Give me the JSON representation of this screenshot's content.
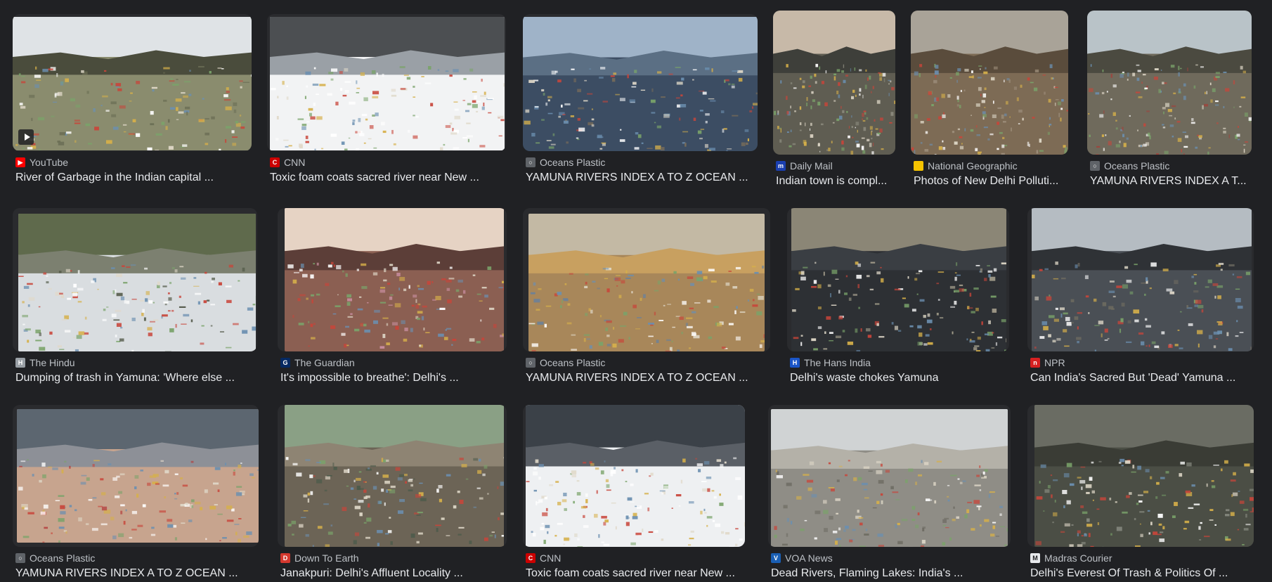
{
  "results": [
    {
      "source": "YouTube",
      "title": "River of Garbage in the Indian capital ...",
      "favicon_icon": "youtube-icon",
      "favicon_color": "#ff0000",
      "favicon_glyph": "▶",
      "thumb_colors": [
        "#dfe3e6",
        "#8a8c6e",
        "#6b6e55",
        "#4a4c3c"
      ],
      "has_play": true
    },
    {
      "source": "CNN",
      "title": "Toxic foam coats sacred river near New ...",
      "favicon_icon": "cnn-icon",
      "favicon_color": "#cc0000",
      "favicon_glyph": "C",
      "thumb_colors": [
        "#4c4f52",
        "#f2f3f4",
        "#ffffff",
        "#9aa0a6"
      ],
      "has_play": false
    },
    {
      "source": "Oceans Plastic",
      "title": "YAMUNA RIVERS INDEX A TO Z OCEAN ...",
      "favicon_icon": "oceans-plastic-icon",
      "favicon_color": "#5f6368",
      "favicon_glyph": "○",
      "thumb_colors": [
        "#9fb3c8",
        "#3c4d63",
        "#7a6d59",
        "#5b6f84"
      ],
      "has_play": false
    },
    {
      "source": "Daily Mail",
      "title": "Indian town is compl...",
      "favicon_icon": "daily-mail-icon",
      "favicon_color": "#1a3fb0",
      "favicon_glyph": "m",
      "thumb_colors": [
        "#c7b9a8",
        "#5f5d52",
        "#8b8a7d",
        "#3e3f3a"
      ],
      "has_play": false
    },
    {
      "source": "National Geographic",
      "title": "Photos of New Delhi Polluti...",
      "favicon_icon": "national-geographic-icon",
      "favicon_color": "#f6c400",
      "favicon_glyph": "",
      "thumb_colors": [
        "#a9a398",
        "#7d6b55",
        "#9c8d7a",
        "#5a4c3c"
      ],
      "has_play": false
    },
    {
      "source": "Oceans Plastic",
      "title": "YAMUNA RIVERS INDEX A T...",
      "favicon_icon": "oceans-plastic-icon",
      "favicon_color": "#5f6368",
      "favicon_glyph": "○",
      "thumb_colors": [
        "#b9c3c8",
        "#6f6a5c",
        "#a0423b",
        "#4b4a40"
      ],
      "has_play": false
    },
    {
      "source": "The Hindu",
      "title": "Dumping of trash in Yamuna: 'Where else ...",
      "favicon_icon": "the-hindu-icon",
      "favicon_color": "#9aa0a6",
      "favicon_glyph": "H",
      "thumb_colors": [
        "#5f6a4c",
        "#d9dde0",
        "#4b5240",
        "#7c8070"
      ],
      "has_play": false
    },
    {
      "source": "The Guardian",
      "title": "It's impossible to breathe': Delhi's ...",
      "favicon_icon": "the-guardian-icon",
      "favicon_color": "#052962",
      "favicon_glyph": "G",
      "thumb_colors": [
        "#e6d3c4",
        "#8b5f52",
        "#c98ea0",
        "#5c3e38"
      ],
      "has_play": false
    },
    {
      "source": "Oceans Plastic",
      "title": "YAMUNA RIVERS INDEX A TO Z OCEAN ...",
      "favicon_icon": "oceans-plastic-icon",
      "favicon_color": "#5f6368",
      "favicon_glyph": "○",
      "thumb_colors": [
        "#c3b9a4",
        "#a8875a",
        "#6c8198",
        "#c8a060"
      ],
      "has_play": false
    },
    {
      "source": "The Hans India",
      "title": "Delhi's waste chokes Yamuna",
      "favicon_icon": "the-hans-india-icon",
      "favicon_color": "#1a55c8",
      "favicon_glyph": "H",
      "thumb_colors": [
        "#8b8676",
        "#2d3034",
        "#a6a08d",
        "#3a3e43"
      ],
      "has_play": false
    },
    {
      "source": "NPR",
      "title": "Can India's Sacred But 'Dead' Yamuna ...",
      "favicon_icon": "npr-icon",
      "favicon_color": "#d62021",
      "favicon_glyph": "n",
      "thumb_colors": [
        "#b5bcc2",
        "#4a4f55",
        "#6d6a60",
        "#2f3236"
      ],
      "has_play": false
    },
    {
      "source": "Oceans Plastic",
      "title": "YAMUNA RIVERS INDEX A TO Z OCEAN ...",
      "favicon_icon": "oceans-plastic-icon",
      "favicon_color": "#5f6368",
      "favicon_glyph": "○",
      "thumb_colors": [
        "#5c6670",
        "#c7a48e",
        "#b33a3a",
        "#8d9097"
      ],
      "has_play": false
    },
    {
      "source": "Down To Earth",
      "title": "Janakpuri: Delhi's Affluent Locality ...",
      "favicon_icon": "down-to-earth-icon",
      "favicon_color": "#d4382e",
      "favicon_glyph": "D",
      "thumb_colors": [
        "#8aa085",
        "#6c6456",
        "#4b5a4a",
        "#8e8473"
      ],
      "has_play": false
    },
    {
      "source": "CNN",
      "title": "Toxic foam coats sacred river near New ...",
      "favicon_icon": "cnn-icon",
      "favicon_color": "#cc0000",
      "favicon_glyph": "C",
      "thumb_colors": [
        "#3b4148",
        "#eef0f2",
        "#ffffff",
        "#5a5f66"
      ],
      "has_play": false
    },
    {
      "source": "VOA News",
      "title": "Dead Rivers, Flaming Lakes: India's ...",
      "favicon_icon": "voa-news-icon",
      "favicon_color": "#1a5fb4",
      "favicon_glyph": "V",
      "thumb_colors": [
        "#d0d3d4",
        "#8f8d86",
        "#6d6b62",
        "#b4b1a8"
      ],
      "has_play": false
    },
    {
      "source": "Madras Courier",
      "title": "Delhi's Everest Of Trash & Politics Of ...",
      "favicon_icon": "madras-courier-icon",
      "favicon_color": "#e8eaed",
      "favicon_glyph": "M",
      "thumb_colors": [
        "#6a6c63",
        "#4b4e45",
        "#8b8e84",
        "#3a3c35"
      ],
      "has_play": false
    }
  ]
}
